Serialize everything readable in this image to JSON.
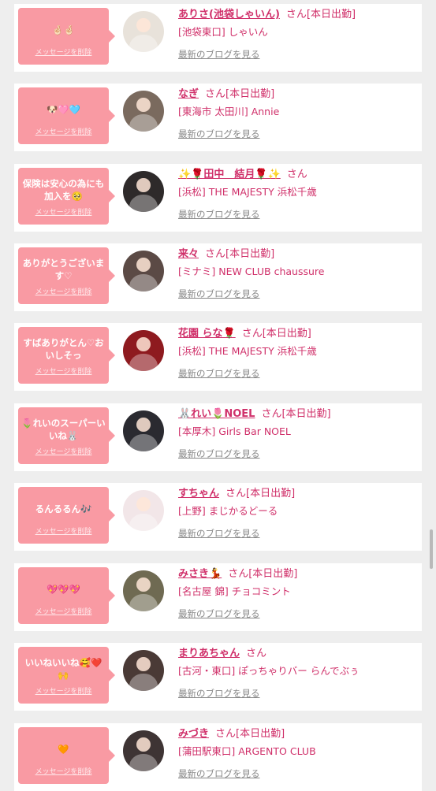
{
  "items": [
    {
      "message": "🤞🏻🤞🏻",
      "delete_label": "メッセージを削除",
      "name": "ありさ(池袋しゃいん)",
      "suffix": "さん[本日出勤]",
      "shop": "[池袋東口] しゃいん",
      "blog_link": "最新のブログを見る",
      "avatar_color": "#e8e2da"
    },
    {
      "message": "🐶🩷🩵",
      "delete_label": "メッセージを削除",
      "name": "なぎ",
      "suffix": "さん[本日出勤]",
      "shop": "[東海市 太田川] Annie",
      "blog_link": "最新のブログを見る",
      "avatar_color": "#7a6a5e"
    },
    {
      "message": "保険は安心の為にも加入を🥺",
      "delete_label": "メッセージを削除",
      "name": "✨🌹田中　結月🌹✨",
      "suffix": "さん",
      "shop": "[浜松] THE MAJESTY 浜松千歳",
      "blog_link": "最新のブログを見る",
      "avatar_color": "#2e2a2a"
    },
    {
      "message": "ありがとうございます♡",
      "delete_label": "メッセージを削除",
      "name": "来々",
      "suffix": "さん[本日出勤]",
      "shop": "[ミナミ] NEW CLUB chaussure",
      "blog_link": "最新のブログを見る",
      "avatar_color": "#5b4a45"
    },
    {
      "message": "すばありがとん♡おいしそっ",
      "delete_label": "メッセージを削除",
      "name": "花園 らな🌹",
      "suffix": "さん[本日出勤]",
      "shop": "[浜松] THE MAJESTY 浜松千歳",
      "blog_link": "最新のブログを見る",
      "avatar_color": "#8e1a1f"
    },
    {
      "message": "🌷れいのスーパーいいね🐰",
      "delete_label": "メッセージを削除",
      "name": "🐰れい🌷NOEL",
      "suffix": "さん[本日出勤]",
      "shop": "[本厚木] Girls Bar NOEL",
      "blog_link": "最新のブログを見る",
      "avatar_color": "#2a2a30"
    },
    {
      "message": "るんるるん🎶",
      "delete_label": "メッセージを削除",
      "name": "すちゃん",
      "suffix": "さん[本日出勤]",
      "shop": "[上野] まじかるどーる",
      "blog_link": "最新のブログを見る",
      "avatar_color": "#f2e6e8"
    },
    {
      "message": "💖💖💖",
      "delete_label": "メッセージを削除",
      "name": "みさき💃",
      "suffix": "さん[本日出勤]",
      "shop": "[名古屋 錦] チョコミント",
      "blog_link": "最新のブログを見る",
      "avatar_color": "#6f6a52"
    },
    {
      "message": "いいねいいね🥰❤️🙌",
      "delete_label": "メッセージを削除",
      "name": "まりあちゃん",
      "suffix": "さん",
      "shop": "[古河・東口] ぽっちゃりバー らんでぶぅ",
      "blog_link": "最新のブログを見る",
      "avatar_color": "#4a3a36"
    },
    {
      "message": "🧡",
      "delete_label": "メッセージを削除",
      "name": "みづき",
      "suffix": "さん[本日出勤]",
      "shop": "[蒲田駅東口] ARGENTO CLUB",
      "blog_link": "最新のブログを見る",
      "avatar_color": "#3e3434"
    }
  ]
}
